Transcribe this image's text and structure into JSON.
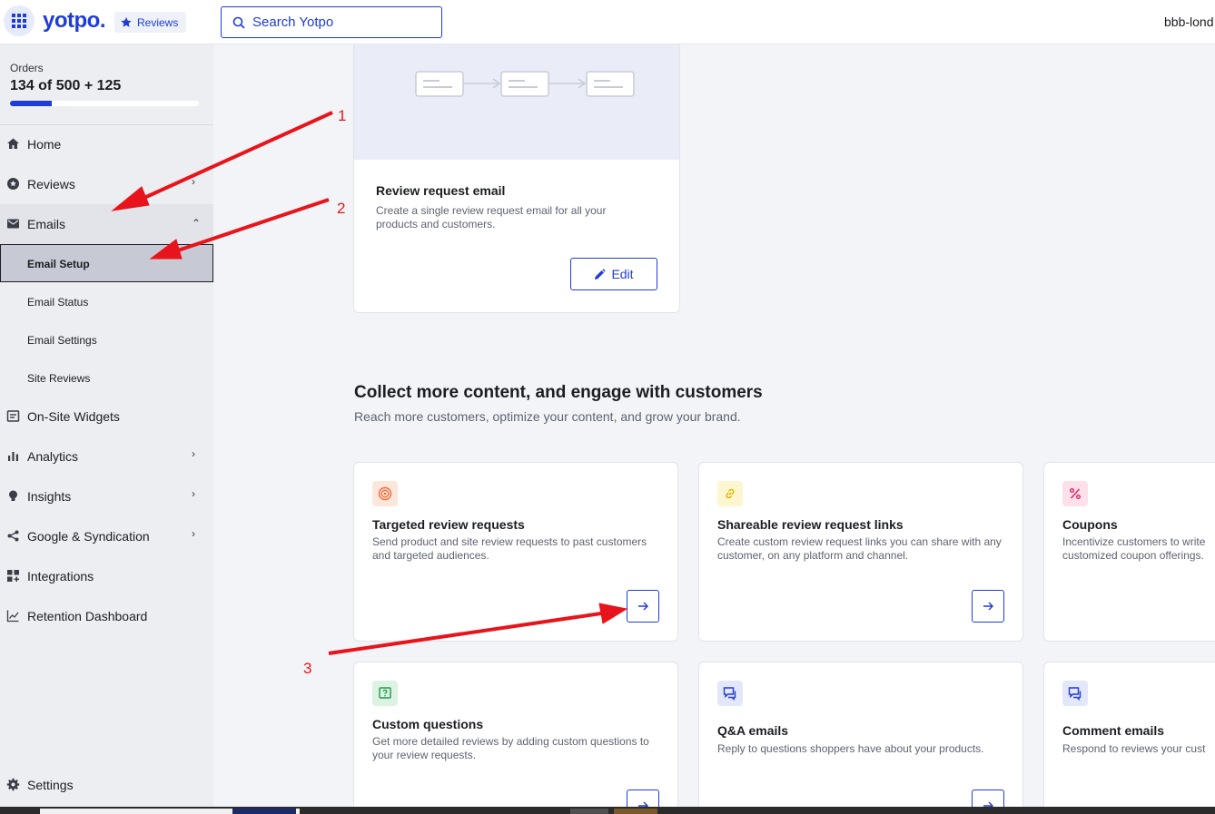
{
  "header": {
    "logo": "yotpo.",
    "product": "Reviews",
    "search_placeholder": "Search Yotpo",
    "account": "bbb-lond"
  },
  "sidebar": {
    "orders_label": "Orders",
    "orders_value": "134 of 500 + 125",
    "orders_progress": 0.22,
    "items": [
      {
        "label": "Home",
        "icon": "home-icon"
      },
      {
        "label": "Reviews",
        "icon": "star-badge-icon"
      },
      {
        "label": "Emails",
        "icon": "mail-icon"
      },
      {
        "label": "On-Site Widgets",
        "icon": "widget-icon"
      },
      {
        "label": "Analytics",
        "icon": "bar-chart-icon"
      },
      {
        "label": "Insights",
        "icon": "lightbulb-icon"
      },
      {
        "label": "Google & Syndication",
        "icon": "share-icon"
      },
      {
        "label": "Integrations",
        "icon": "grid-plus-icon"
      },
      {
        "label": "Retention Dashboard",
        "icon": "line-chart-icon"
      }
    ],
    "email_sub": [
      "Email Setup",
      "Email Status",
      "Email Settings",
      "Site Reviews"
    ],
    "settings": "Settings"
  },
  "hero": {
    "title": "Review request email",
    "desc": "Create a single review request email for all your products and customers.",
    "edit_label": "Edit"
  },
  "section": {
    "title": "Collect more content, and engage with customers",
    "subtitle": "Reach more customers, optimize your content, and grow your brand."
  },
  "features": [
    {
      "title": "Targeted review requests",
      "desc": "Send product and site review requests to past customers and targeted audiences.",
      "icon": "target-icon",
      "color": "#f26b3a",
      "bg": "#fde6da"
    },
    {
      "title": "Shareable review request links",
      "desc": "Create custom review request links you can share with any customer, on any platform and channel.",
      "icon": "link-icon",
      "color": "#e0b400",
      "bg": "#fdf6cf"
    },
    {
      "title": "Coupons",
      "desc": "Incentivize customers to write customized coupon offerings.",
      "icon": "percent-icon",
      "color": "#e0246b",
      "bg": "#fde0ea"
    },
    {
      "title": "Custom questions",
      "desc": "Get more detailed reviews by adding custom questions to your review requests.",
      "icon": "question-icon",
      "color": "#1f9a4c",
      "bg": "#dcf3e3"
    },
    {
      "title": "Q&A emails",
      "desc": "Reply to questions shoppers have about your products.",
      "icon": "chat-icon",
      "color": "#1f3cd8",
      "bg": "#e2e7fb"
    },
    {
      "title": "Comment emails",
      "desc": "Respond to reviews your cust",
      "icon": "chat-icon",
      "color": "#1f3cd8",
      "bg": "#e2e7fb"
    }
  ],
  "annotations": [
    "1",
    "2",
    "3"
  ],
  "colors": {
    "accent": "#1f3cd8",
    "annotation": "#e8141b"
  }
}
